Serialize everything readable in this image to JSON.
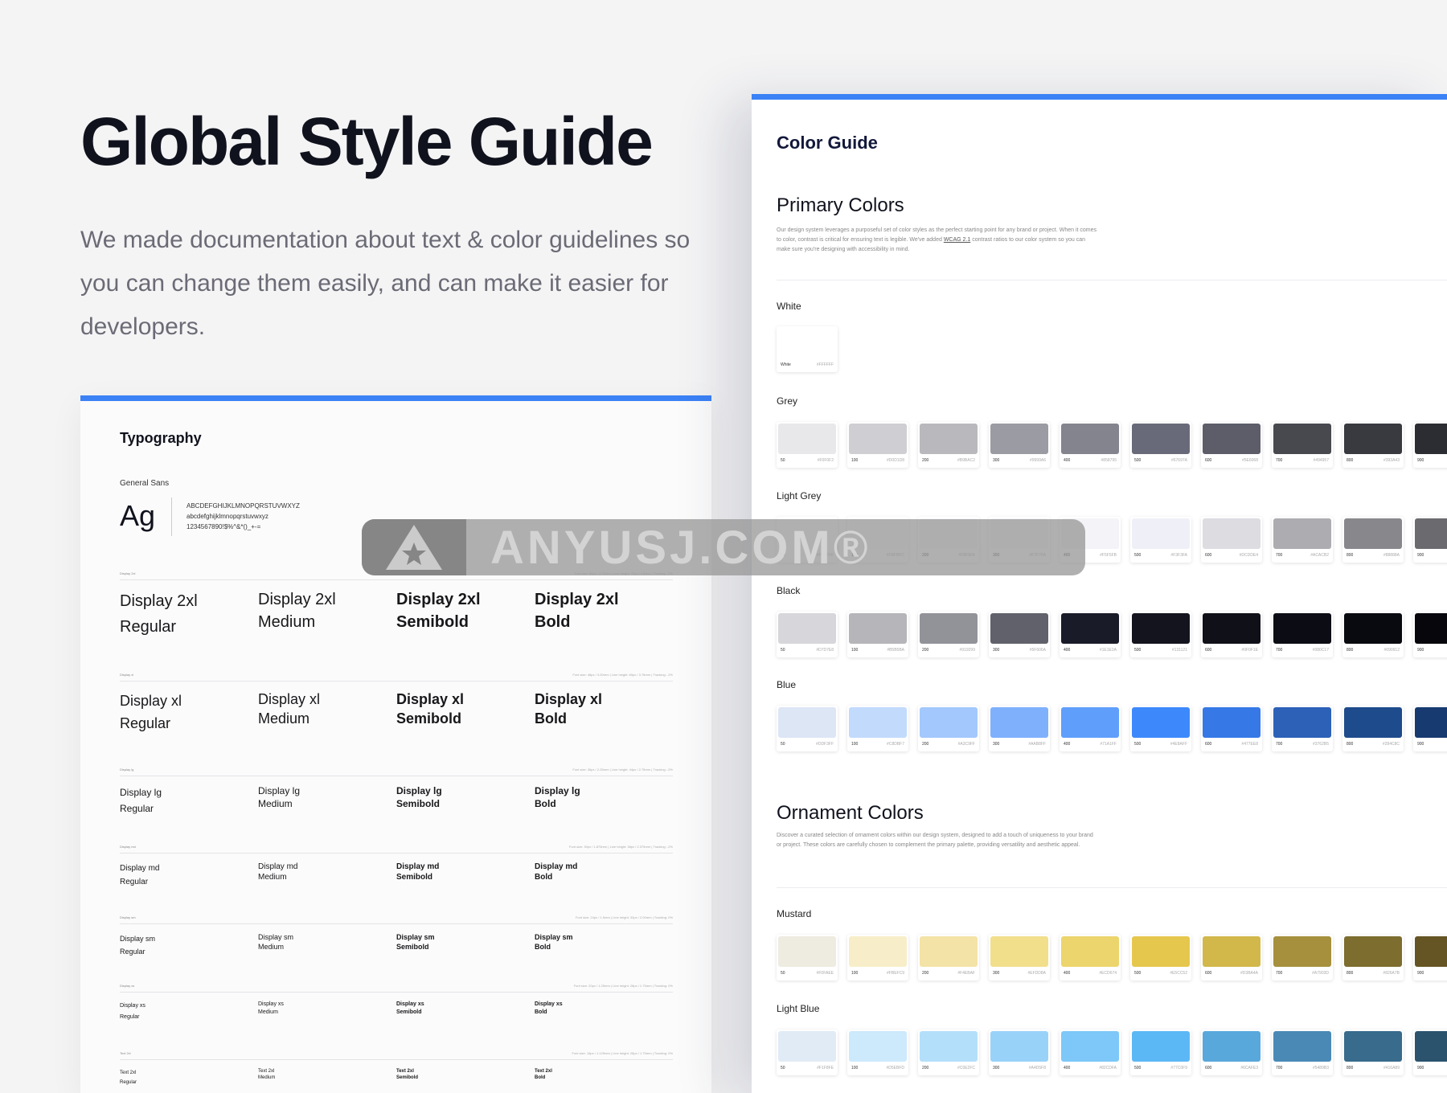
{
  "hero": {
    "title": "Global Style Guide",
    "description": "We made documentation about text & color guidelines so you can change them easily, and can make it easier for developers."
  },
  "typography": {
    "title": "Typography",
    "font_name": "General Sans",
    "ag": "Ag",
    "charset_upper": "ABCDEFGHIJKLMNOPQRSTUVWXYZ",
    "charset_lower": "abcdefghijklmnopqrstuvwxyz",
    "charset_digits": "1234567890!$%^&*()_+-="
  },
  "type_scales": [
    {
      "label": "Display 2xl",
      "spec": "Font size: 60px / 3.75rem | Line height: 72px / 4.5rem | Tracking: -2%",
      "samples": [
        {
          "name": "Display 2xl",
          "weight": "Regular"
        },
        {
          "name": "Display 2xl",
          "weight": "Medium"
        },
        {
          "name": "Display 2xl",
          "weight": "Semibold"
        },
        {
          "name": "Display 2xl",
          "weight": "Bold"
        }
      ]
    },
    {
      "label": "Display xl",
      "spec": "Font size: 48px / 3.00rem | Line height: 60px / 3.75rem | Tracking: -2%",
      "samples": [
        {
          "name": "Display xl",
          "weight": "Regular"
        },
        {
          "name": "Display xl",
          "weight": "Medium"
        },
        {
          "name": "Display xl",
          "weight": "Semibold"
        },
        {
          "name": "Display xl",
          "weight": "Bold"
        }
      ]
    },
    {
      "label": "Display lg",
      "spec": "Font size: 36px / 2.25rem | Line height: 44px / 2.75rem | Tracking: -2%",
      "samples": [
        {
          "name": "Display lg",
          "weight": "Regular"
        },
        {
          "name": "Display lg",
          "weight": "Medium"
        },
        {
          "name": "Display lg",
          "weight": "Semibold"
        },
        {
          "name": "Display lg",
          "weight": "Bold"
        }
      ]
    },
    {
      "label": "Display md",
      "spec": "Font size: 30px / 1.875rem | Line height: 38px / 2.375rem | Tracking: -2%",
      "samples": [
        {
          "name": "Display md",
          "weight": "Regular"
        },
        {
          "name": "Display md",
          "weight": "Medium"
        },
        {
          "name": "Display md",
          "weight": "Semibold"
        },
        {
          "name": "Display md",
          "weight": "Bold"
        }
      ]
    },
    {
      "label": "Display sm",
      "spec": "Font size: 24px / 1.5rem | Line height: 32px / 2.00rem | Tracking: 0%",
      "samples": [
        {
          "name": "Display sm",
          "weight": "Regular"
        },
        {
          "name": "Display sm",
          "weight": "Medium"
        },
        {
          "name": "Display sm",
          "weight": "Semibold"
        },
        {
          "name": "Display sm",
          "weight": "Bold"
        }
      ]
    },
    {
      "label": "Display xs",
      "spec": "Font size: 20px / 1.25rem | Line height: 28px / 1.75rem | Tracking: 0%",
      "samples": [
        {
          "name": "Display xs",
          "weight": "Regular"
        },
        {
          "name": "Display xs",
          "weight": "Medium"
        },
        {
          "name": "Display xs",
          "weight": "Semibold"
        },
        {
          "name": "Display xs",
          "weight": "Bold"
        }
      ]
    },
    {
      "label": "Text 2xl",
      "spec": "Font size: 18px / 1.125rem | Line height: 28px / 1.75rem | Tracking: 0%",
      "samples": [
        {
          "name": "Text 2xl",
          "weight": "Regular"
        },
        {
          "name": "Text 2xl",
          "weight": "Medium"
        },
        {
          "name": "Text 2xl",
          "weight": "Semibold"
        },
        {
          "name": "Text 2xl",
          "weight": "Bold"
        }
      ]
    }
  ],
  "color_guide": {
    "title": "Color Guide",
    "primary": {
      "title": "Primary Colors",
      "desc_1": "Our design system leverages a purposeful set of color styles as the perfect starting point for any brand or project. When it comes to color, contrast is critical for ensuring text is legible. We've added ",
      "desc_link": "WCAG 2.1",
      "desc_2": " contrast ratios to our color system so you can make sure you're designing with accessibility in mind."
    },
    "ornament": {
      "title": "Ornament Colors",
      "desc": "Discover a curated selection of ornament colors within our design system, designed to add a touch of uniqueness to your brand or project. These colors are carefully chosen to complement the primary palette, providing versatility and aesthetic appeal."
    },
    "white": {
      "label": "White",
      "name": "White",
      "hex": "#FFFFFF",
      "color": "#ffffff"
    },
    "palettes": [
      {
        "label": "Grey",
        "swatches": [
          {
            "name": "50",
            "hex": "#F0F0F2",
            "color": "#e8e8ea"
          },
          {
            "name": "100",
            "hex": "#D0D1D8",
            "color": "#cfcfd3"
          },
          {
            "name": "200",
            "hex": "#B9BAC2",
            "color": "#b8b8bd"
          },
          {
            "name": "300",
            "hex": "#9999A6",
            "color": "#9b9ba3"
          },
          {
            "name": "400",
            "hex": "#858795",
            "color": "#84848f"
          },
          {
            "name": "500",
            "hex": "#67697A",
            "color": "#696a79"
          },
          {
            "name": "600",
            "hex": "#5E6068",
            "color": "#5c5d69"
          },
          {
            "name": "700",
            "hex": "#494957",
            "color": "#48494f"
          },
          {
            "name": "800",
            "hex": "#393A43",
            "color": "#393a40"
          },
          {
            "name": "900",
            "hex": "",
            "color": "#2c2c33"
          }
        ]
      },
      {
        "label": "Light Grey",
        "swatches": [
          {
            "name": "50",
            "hex": "#FFFFFF",
            "color": "#ffffff"
          },
          {
            "name": "100",
            "hex": "#FBFBFC",
            "color": "#fbfbfc"
          },
          {
            "name": "200",
            "hex": "#F8F8FA",
            "color": "#f8f8fa"
          },
          {
            "name": "300",
            "hex": "#F7F7FA",
            "color": "#f6f6f9"
          },
          {
            "name": "400",
            "hex": "#F5F5FB",
            "color": "#f4f4f8"
          },
          {
            "name": "500",
            "hex": "#F3F3FA",
            "color": "#eff0f7"
          },
          {
            "name": "600",
            "hex": "#DCDDE4",
            "color": "#dcdce1"
          },
          {
            "name": "700",
            "hex": "#ACACB2",
            "color": "#acacb1"
          },
          {
            "name": "800",
            "hex": "#88888A",
            "color": "#88888c"
          },
          {
            "name": "900",
            "hex": "",
            "color": "#6b6b6f"
          }
        ]
      },
      {
        "label": "Black",
        "swatches": [
          {
            "name": "50",
            "hex": "#D7D7E8",
            "color": "#d6d6db"
          },
          {
            "name": "100",
            "hex": "#B5B5BA",
            "color": "#b5b5ba"
          },
          {
            "name": "200",
            "hex": "#919299",
            "color": "#929299"
          },
          {
            "name": "300",
            "hex": "#5F606A",
            "color": "#60616a"
          },
          {
            "name": "400",
            "hex": "#1E1E2A",
            "color": "#1a1b29"
          },
          {
            "name": "500",
            "hex": "#131121",
            "color": "#14141f"
          },
          {
            "name": "600",
            "hex": "#0F0F1E",
            "color": "#101019"
          },
          {
            "name": "700",
            "hex": "#080C17",
            "color": "#0c0c15"
          },
          {
            "name": "800",
            "hex": "#090912",
            "color": "#090910"
          },
          {
            "name": "900",
            "hex": "",
            "color": "#06060c"
          }
        ]
      },
      {
        "label": "Blue",
        "swatches": [
          {
            "name": "50",
            "hex": "#DDF3FF",
            "color": "#dde6f5"
          },
          {
            "name": "100",
            "hex": "#C8DBF7",
            "color": "#c2dafc"
          },
          {
            "name": "200",
            "hex": "#A3C9FF",
            "color": "#a3c8fd"
          },
          {
            "name": "300",
            "hex": "#AAB8FF",
            "color": "#7fb0fc"
          },
          {
            "name": "400",
            "hex": "#71A1FF",
            "color": "#5f9ffb"
          },
          {
            "name": "500",
            "hex": "#4E8AFF",
            "color": "#3d89fb"
          },
          {
            "name": "600",
            "hex": "#477EE8",
            "color": "#3679e6"
          },
          {
            "name": "700",
            "hex": "#3762B5",
            "color": "#2c61b7"
          },
          {
            "name": "800",
            "hex": "#284C8C",
            "color": "#1e4b8b"
          },
          {
            "name": "900",
            "hex": "",
            "color": "#173a70"
          }
        ]
      }
    ],
    "ornament_palettes": [
      {
        "label": "Mustard",
        "swatches": [
          {
            "name": "50",
            "hex": "#F0FAEE",
            "color": "#eeebe0"
          },
          {
            "name": "100",
            "hex": "#FBEFC9",
            "color": "#f7eec9"
          },
          {
            "name": "200",
            "hex": "#F4EBAF",
            "color": "#f4e3a6"
          },
          {
            "name": "300",
            "hex": "#EFDD8A",
            "color": "#f2df8c"
          },
          {
            "name": "400",
            "hex": "#ECD674",
            "color": "#ecd56c"
          },
          {
            "name": "500",
            "hex": "#E5CC52",
            "color": "#e6c74e"
          },
          {
            "name": "600",
            "hex": "#D3BA4A",
            "color": "#d2b84b"
          },
          {
            "name": "700",
            "hex": "#A7903D",
            "color": "#a6903d"
          },
          {
            "name": "800",
            "hex": "#826A7B",
            "color": "#7d6d2f"
          },
          {
            "name": "900",
            "hex": "",
            "color": "#655424"
          }
        ]
      },
      {
        "label": "Light Blue",
        "swatches": [
          {
            "name": "50",
            "hex": "#F1F8FE",
            "color": "#e0ebf5"
          },
          {
            "name": "100",
            "hex": "#D5EBFD",
            "color": "#cde9fc"
          },
          {
            "name": "200",
            "hex": "#C0E2FC",
            "color": "#b4dffa"
          },
          {
            "name": "300",
            "hex": "#A4D5F8",
            "color": "#99d2f9"
          },
          {
            "name": "400",
            "hex": "#82CDFA",
            "color": "#7dc8f8"
          },
          {
            "name": "500",
            "hex": "#77C0F9",
            "color": "#5cb8f5"
          },
          {
            "name": "600",
            "hex": "#6CAFE3",
            "color": "#58a8dc"
          },
          {
            "name": "700",
            "hex": "#5489B3",
            "color": "#4a89b5"
          },
          {
            "name": "800",
            "hex": "#416A89",
            "color": "#386b8c"
          },
          {
            "name": "900",
            "hex": "",
            "color": "#2b536d"
          }
        ]
      }
    ]
  },
  "watermark": {
    "text": "ANYUSJ.COM®"
  },
  "colors": {
    "accent": "#3b82f6",
    "title_dark": "#10121d"
  }
}
